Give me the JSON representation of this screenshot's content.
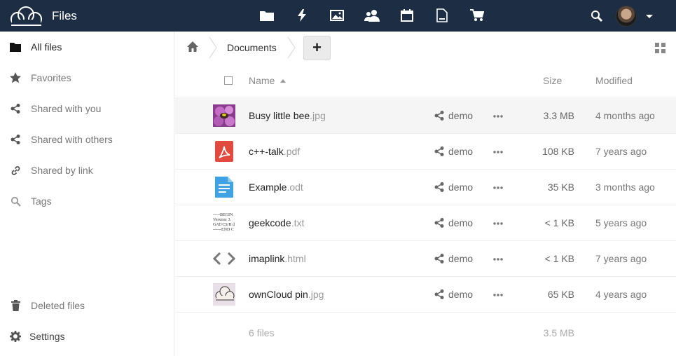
{
  "header": {
    "app_name": "Files",
    "apps": [
      "files-icon",
      "activity-icon",
      "gallery-icon",
      "contacts-icon",
      "calendar-icon",
      "documents-icon",
      "market-icon"
    ]
  },
  "sidebar": {
    "items": [
      {
        "label": "All files",
        "icon": "folder-icon"
      },
      {
        "label": "Favorites",
        "icon": "star-icon"
      },
      {
        "label": "Shared with you",
        "icon": "share-icon"
      },
      {
        "label": "Shared with others",
        "icon": "share-icon"
      },
      {
        "label": "Shared by link",
        "icon": "link-icon"
      },
      {
        "label": "Tags",
        "icon": "tag-icon"
      }
    ],
    "bottom": [
      {
        "label": "Deleted files",
        "icon": "trash-icon"
      },
      {
        "label": "Settings",
        "icon": "gear-icon"
      }
    ]
  },
  "breadcrumb": {
    "current": "Documents",
    "new_label": "+"
  },
  "table": {
    "headers": {
      "name": "Name",
      "size": "Size",
      "modified": "Modified"
    },
    "rows": [
      {
        "base": "Busy little bee",
        "ext": ".jpg",
        "share": "demo",
        "size": "3.3 MB",
        "modified": "4 months ago"
      },
      {
        "base": "c++-talk",
        "ext": ".pdf",
        "share": "demo",
        "size": "108 KB",
        "modified": "7 years ago"
      },
      {
        "base": "Example",
        "ext": ".odt",
        "share": "demo",
        "size": "35 KB",
        "modified": "3 months ago"
      },
      {
        "base": "geekcode",
        "ext": ".txt",
        "share": "demo",
        "size": "< 1 KB",
        "modified": "5 years ago"
      },
      {
        "base": "imaplink",
        "ext": ".html",
        "share": "demo",
        "size": "< 1 KB",
        "modified": "7 years ago"
      },
      {
        "base": "ownCloud pin",
        "ext": ".jpg",
        "share": "demo",
        "size": "65 KB",
        "modified": "4 years ago"
      }
    ],
    "summary": {
      "count": "6 files",
      "total": "3.5 MB"
    }
  },
  "geekcode_preview": [
    "-----BEGIN",
    "Version: 3.",
    "GAT/CS/B d",
    "------END C"
  ],
  "colors": {
    "header_bg": "#1d2d44",
    "pdf_red": "#e34a3f",
    "doc_blue": "#3fa3e3"
  }
}
